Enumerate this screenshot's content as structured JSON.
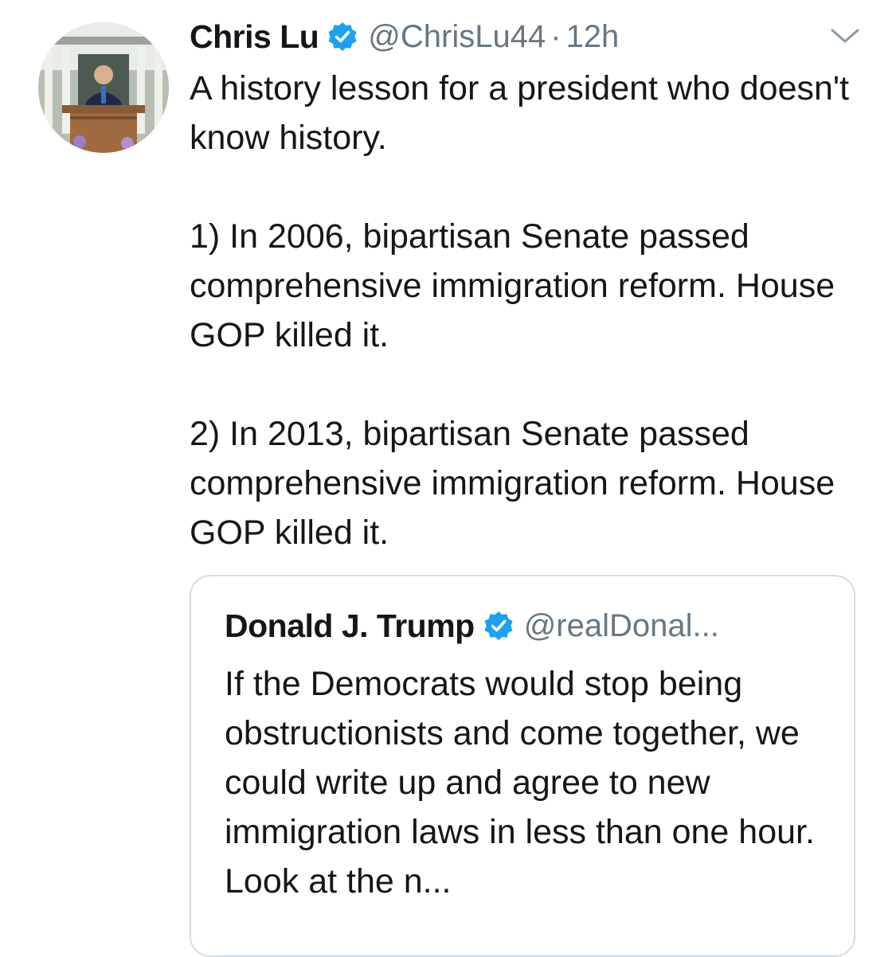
{
  "tweet": {
    "author": {
      "display_name": "Chris Lu",
      "handle": "@ChrisLu44",
      "verified": true,
      "avatar_icon": "avatar-photo-podium-speaker"
    },
    "separator": "·",
    "timestamp": "12h",
    "menu_icon": "chevron-down-icon",
    "paragraphs": [
      "A history lesson for a president who doesn't know history.",
      "1) In 2006, bipartisan Senate passed comprehensive immigration reform. House GOP killed it.",
      "2) In 2013, bipartisan Senate passed comprehensive immigration reform. House GOP killed it."
    ],
    "quoted_tweet": {
      "display_name": "Donald J. Trump",
      "handle": "@realDonal...",
      "verified": true,
      "text": "If the Democrats would stop being obstructionists and come together, we could write up and agree to new immigration laws in less than one hour. Look at the n..."
    }
  },
  "colors": {
    "text_primary": "#14171a",
    "text_secondary": "#657786",
    "verified_blue": "#1da1f2",
    "border": "#d5dde3",
    "background": "#ffffff"
  }
}
